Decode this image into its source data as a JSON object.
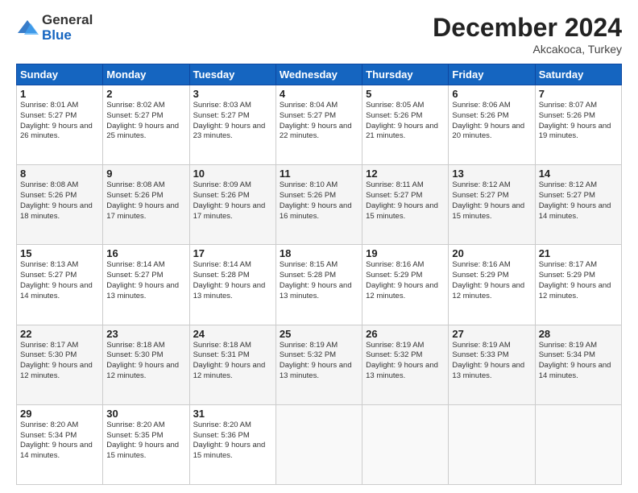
{
  "logo": {
    "general": "General",
    "blue": "Blue"
  },
  "title": "December 2024",
  "location": "Akcakoca, Turkey",
  "days_of_week": [
    "Sunday",
    "Monday",
    "Tuesday",
    "Wednesday",
    "Thursday",
    "Friday",
    "Saturday"
  ],
  "weeks": [
    [
      {
        "day": 1,
        "sunrise": "8:01 AM",
        "sunset": "5:27 PM",
        "daylight": "9 hours and 26 minutes."
      },
      {
        "day": 2,
        "sunrise": "8:02 AM",
        "sunset": "5:27 PM",
        "daylight": "9 hours and 25 minutes."
      },
      {
        "day": 3,
        "sunrise": "8:03 AM",
        "sunset": "5:27 PM",
        "daylight": "9 hours and 23 minutes."
      },
      {
        "day": 4,
        "sunrise": "8:04 AM",
        "sunset": "5:27 PM",
        "daylight": "9 hours and 22 minutes."
      },
      {
        "day": 5,
        "sunrise": "8:05 AM",
        "sunset": "5:26 PM",
        "daylight": "9 hours and 21 minutes."
      },
      {
        "day": 6,
        "sunrise": "8:06 AM",
        "sunset": "5:26 PM",
        "daylight": "9 hours and 20 minutes."
      },
      {
        "day": 7,
        "sunrise": "8:07 AM",
        "sunset": "5:26 PM",
        "daylight": "9 hours and 19 minutes."
      }
    ],
    [
      {
        "day": 8,
        "sunrise": "8:08 AM",
        "sunset": "5:26 PM",
        "daylight": "9 hours and 18 minutes."
      },
      {
        "day": 9,
        "sunrise": "8:08 AM",
        "sunset": "5:26 PM",
        "daylight": "9 hours and 17 minutes."
      },
      {
        "day": 10,
        "sunrise": "8:09 AM",
        "sunset": "5:26 PM",
        "daylight": "9 hours and 17 minutes."
      },
      {
        "day": 11,
        "sunrise": "8:10 AM",
        "sunset": "5:26 PM",
        "daylight": "9 hours and 16 minutes."
      },
      {
        "day": 12,
        "sunrise": "8:11 AM",
        "sunset": "5:27 PM",
        "daylight": "9 hours and 15 minutes."
      },
      {
        "day": 13,
        "sunrise": "8:12 AM",
        "sunset": "5:27 PM",
        "daylight": "9 hours and 15 minutes."
      },
      {
        "day": 14,
        "sunrise": "8:12 AM",
        "sunset": "5:27 PM",
        "daylight": "9 hours and 14 minutes."
      }
    ],
    [
      {
        "day": 15,
        "sunrise": "8:13 AM",
        "sunset": "5:27 PM",
        "daylight": "9 hours and 14 minutes."
      },
      {
        "day": 16,
        "sunrise": "8:14 AM",
        "sunset": "5:27 PM",
        "daylight": "9 hours and 13 minutes."
      },
      {
        "day": 17,
        "sunrise": "8:14 AM",
        "sunset": "5:28 PM",
        "daylight": "9 hours and 13 minutes."
      },
      {
        "day": 18,
        "sunrise": "8:15 AM",
        "sunset": "5:28 PM",
        "daylight": "9 hours and 13 minutes."
      },
      {
        "day": 19,
        "sunrise": "8:16 AM",
        "sunset": "5:29 PM",
        "daylight": "9 hours and 12 minutes."
      },
      {
        "day": 20,
        "sunrise": "8:16 AM",
        "sunset": "5:29 PM",
        "daylight": "9 hours and 12 minutes."
      },
      {
        "day": 21,
        "sunrise": "8:17 AM",
        "sunset": "5:29 PM",
        "daylight": "9 hours and 12 minutes."
      }
    ],
    [
      {
        "day": 22,
        "sunrise": "8:17 AM",
        "sunset": "5:30 PM",
        "daylight": "9 hours and 12 minutes."
      },
      {
        "day": 23,
        "sunrise": "8:18 AM",
        "sunset": "5:30 PM",
        "daylight": "9 hours and 12 minutes."
      },
      {
        "day": 24,
        "sunrise": "8:18 AM",
        "sunset": "5:31 PM",
        "daylight": "9 hours and 12 minutes."
      },
      {
        "day": 25,
        "sunrise": "8:19 AM",
        "sunset": "5:32 PM",
        "daylight": "9 hours and 13 minutes."
      },
      {
        "day": 26,
        "sunrise": "8:19 AM",
        "sunset": "5:32 PM",
        "daylight": "9 hours and 13 minutes."
      },
      {
        "day": 27,
        "sunrise": "8:19 AM",
        "sunset": "5:33 PM",
        "daylight": "9 hours and 13 minutes."
      },
      {
        "day": 28,
        "sunrise": "8:19 AM",
        "sunset": "5:34 PM",
        "daylight": "9 hours and 14 minutes."
      }
    ],
    [
      {
        "day": 29,
        "sunrise": "8:20 AM",
        "sunset": "5:34 PM",
        "daylight": "9 hours and 14 minutes."
      },
      {
        "day": 30,
        "sunrise": "8:20 AM",
        "sunset": "5:35 PM",
        "daylight": "9 hours and 15 minutes."
      },
      {
        "day": 31,
        "sunrise": "8:20 AM",
        "sunset": "5:36 PM",
        "daylight": "9 hours and 15 minutes."
      },
      null,
      null,
      null,
      null
    ]
  ]
}
